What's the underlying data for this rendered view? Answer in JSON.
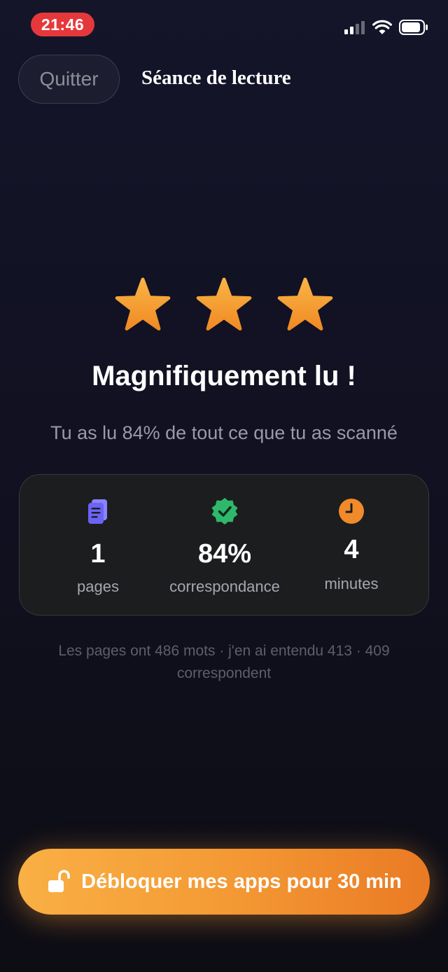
{
  "status_bar": {
    "time": "21:46"
  },
  "header": {
    "quit_label": "Quitter",
    "title": "Séance de lecture"
  },
  "result": {
    "stars_filled": 3,
    "stars_total": 3,
    "headline": "Magnifiquement lu !",
    "subline": "Tu as lu 84% de tout ce que tu as scanné"
  },
  "stats": [
    {
      "icon": "pages-icon",
      "value": "1",
      "label": "pages",
      "color": "#6b63f5"
    },
    {
      "icon": "verified-badge-icon",
      "value": "84%",
      "label": "correspondance",
      "color": "#2fb86b"
    },
    {
      "icon": "clock-icon",
      "value": "4",
      "label": "minutes",
      "color": "#f08a2a"
    }
  ],
  "note": "Les pages ont 486 mots · j'en ai entendu 413 · 409 correspondent",
  "cta": {
    "label": "Débloquer mes apps pour 30 min",
    "icon": "unlock-icon"
  },
  "colors": {
    "accent": "#f49a35",
    "star": "#f7a033",
    "danger": "#e5383b"
  }
}
